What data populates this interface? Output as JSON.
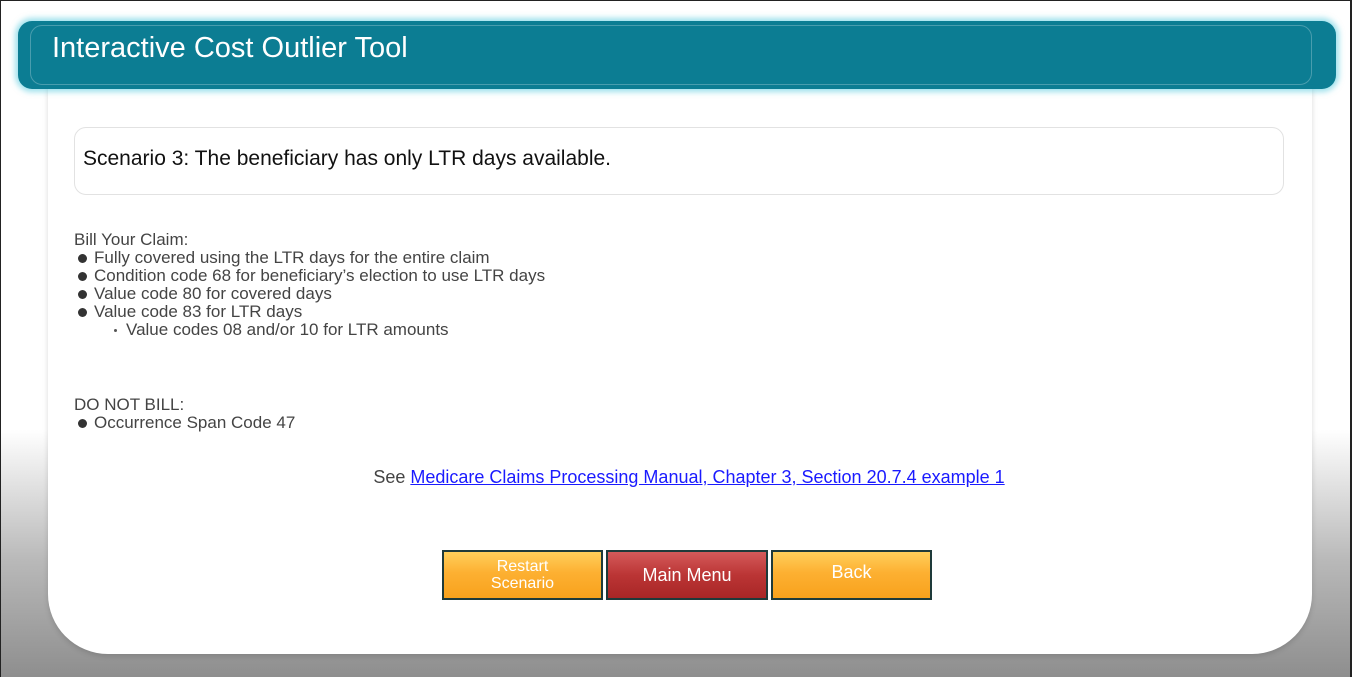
{
  "header": {
    "title": "Interactive Cost Outlier Tool"
  },
  "scenario": {
    "text": "Scenario 3: The beneficiary has only LTR days available."
  },
  "bill_claim": {
    "heading": "Bill Your Claim:",
    "items": [
      "Fully covered using the LTR days for the entire claim",
      "Condition code 68 for beneficiary’s election to use LTR days",
      "Value code 80 for covered days",
      "Value code 83 for LTR days"
    ],
    "sub_item": "Value codes 08 and/or 10 for LTR amounts"
  },
  "do_not_bill": {
    "heading": "DO NOT BILL:",
    "items": [
      "Occurrence Span Code 47"
    ]
  },
  "reference": {
    "prefix": "See",
    "link_text": "Medicare Claims Processing Manual, Chapter 3, Section 20.7.4 example 1"
  },
  "buttons": {
    "restart_line1": "Restart",
    "restart_line2": "Scenario",
    "main_menu": "Main Menu",
    "back": "Back"
  },
  "colors": {
    "header": "#0c7d93",
    "button_orange": "#fdb032",
    "button_red": "#bb3535",
    "link": "#1a1aff"
  }
}
